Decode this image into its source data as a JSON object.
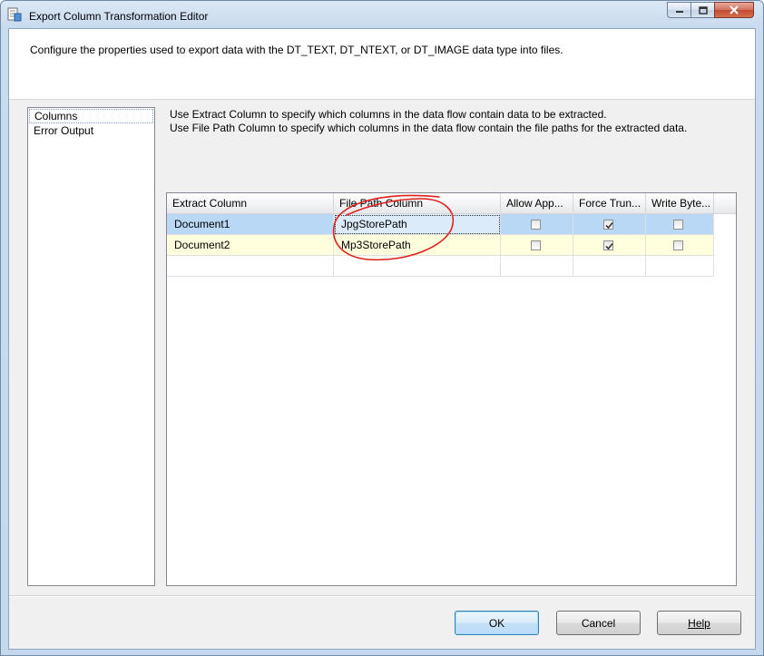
{
  "window": {
    "title": "Export Column Transformation Editor"
  },
  "header": {
    "description": "Configure the properties used to export data with the DT_TEXT, DT_NTEXT, or DT_IMAGE data type into files."
  },
  "nav": {
    "items": [
      {
        "label": "Columns"
      },
      {
        "label": "Error Output"
      }
    ]
  },
  "main": {
    "desc_line1": "Use Extract Column to specify which columns in the data flow contain data to be extracted.",
    "desc_line2": "Use File Path Column to specify which columns in the data flow contain the file paths for the extracted data."
  },
  "grid": {
    "columns": [
      "Extract Column",
      "File Path Column",
      "Allow App...",
      "Force Trun...",
      "Write Byte..."
    ],
    "rows": [
      {
        "extract": "Document1",
        "path": "JpgStorePath",
        "allow_append": false,
        "force_truncate": true,
        "write_bom": false
      },
      {
        "extract": "Document2",
        "path": "Mp3StorePath",
        "allow_append": false,
        "force_truncate": true,
        "write_bom": false
      }
    ]
  },
  "buttons": {
    "ok": "OK",
    "cancel": "Cancel",
    "help": "Help"
  },
  "colors": {
    "selected_row": "#b9d8f5",
    "alt_row": "#ffffde",
    "annotation": "#e0201b"
  }
}
